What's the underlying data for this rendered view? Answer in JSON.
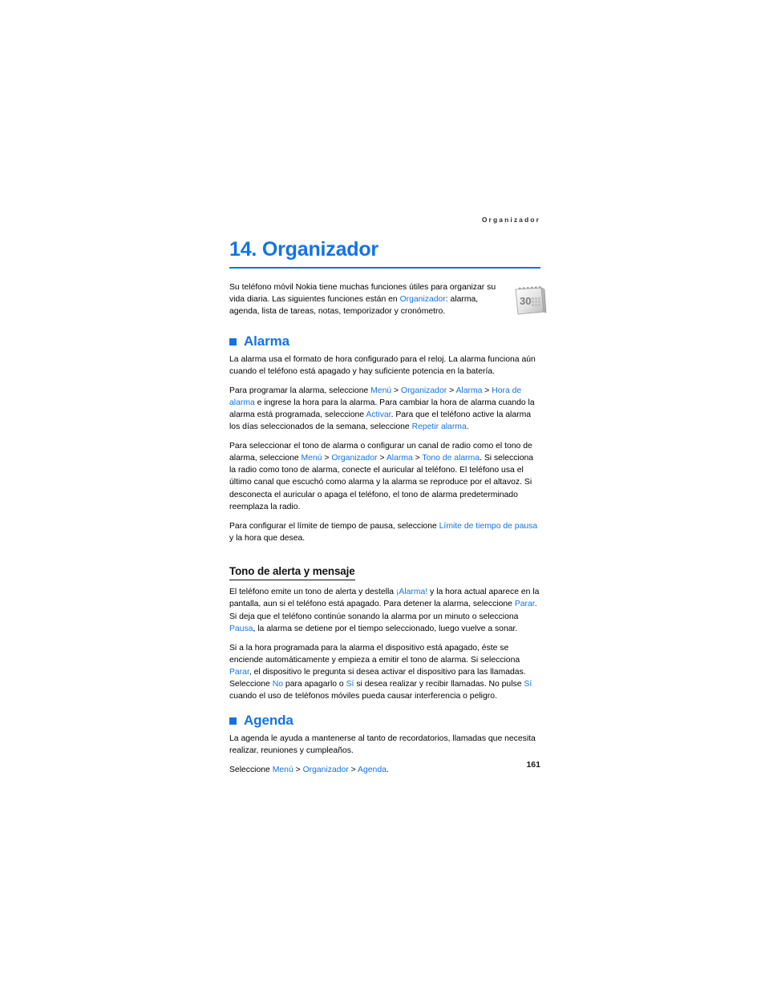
{
  "header": {
    "running_head": "Organizador"
  },
  "title": {
    "text": "14. Organizador"
  },
  "intro": {
    "paragraph_1": "Su teléfono móvil Nokia tiene muchas funciones útiles para organizar su vida diaria. Las siguientes funciones están en ",
    "link_organizador": "Organizador",
    "paragraph_1_tail": ": alarma, agenda, lista de tareas, notas, temporizador y cronómetro.",
    "icon": "calendar-icon",
    "icon_day": "30"
  },
  "sections": [
    {
      "heading": "Alarma",
      "bullet": "square-bullet",
      "paragraphs": {
        "p1": "La alarma usa el formato de hora configurado para el reloj. La alarma funciona aún cuando el teléfono está apagado y hay suficiente potencia en la batería.",
        "p2_a": "Para programar la alarma, seleccione ",
        "p2_l1": "Menú",
        "p2_sep1": " > ",
        "p2_l2": "Organizador",
        "p2_sep2": " > ",
        "p2_l3": "Alarma",
        "p2_sep3": " > ",
        "p2_l4": "Hora de alarma",
        "p2_b": " e ingrese la hora para la alarma. Para cambiar la hora de alarma cuando la alarma está programada, seleccione ",
        "p2_l5": "Activar",
        "p2_c": ". Para que el teléfono active la alarma los días seleccionados de la semana, seleccione ",
        "p2_l6": "Repetir alarma",
        "p2_d": ".",
        "p3_a": "Para seleccionar el tono de alarma o configurar un canal de radio como el tono de alarma, seleccione ",
        "p3_l1": "Menú",
        "p3_sep1": " > ",
        "p3_l2": "Organizador",
        "p3_sep2": " > ",
        "p3_l3": "Alarma",
        "p3_sep3": " > ",
        "p3_l4": "Tono de alarma",
        "p3_b": ". Si selecciona la radio como tono de alarma, conecte el auricular al teléfono. El teléfono usa el último canal que escuchó como alarma y la alarma se reproduce por el altavoz. Si desconecta el auricular o apaga el teléfono, el tono de alarma predeterminado reemplaza la radio.",
        "p4_a": "Para configurar el límite de tiempo de pausa, seleccione ",
        "p4_l1": "Límite de tiempo de pausa",
        "p4_b": " y la hora que desea."
      },
      "subsection": {
        "heading": "Tono de alerta y mensaje",
        "p1_a": "El teléfono emite un tono de alerta y destella ",
        "p1_l1": "¡Alarma!",
        "p1_b": " y la hora actual aparece en la pantalla, aun si el teléfono está apagado. Para detener la alarma, seleccione ",
        "p1_l2": "Parar",
        "p1_c": ". Si deja que el teléfono continúe sonando la alarma por un minuto o selecciona ",
        "p1_l3": "Pausa",
        "p1_d": ", la alarma se detiene por el tiempo seleccionado, luego vuelve a sonar.",
        "p2_a": "Si a la hora programada para la alarma el dispositivo está apagado, éste se enciende automáticamente y empieza a emitir el tono de alarma. Si selecciona ",
        "p2_l1": "Parar",
        "p2_b": ", el dispositivo le pregunta si desea activar el dispositivo para las llamadas. Seleccione ",
        "p2_l2": "No",
        "p2_c": " para apagarlo o ",
        "p2_l3": "Sí",
        "p2_d": " si desea realizar y recibir llamadas. No pulse ",
        "p2_l4": "Sí",
        "p2_e": " cuando el uso de teléfonos móviles pueda causar interferencia o peligro."
      }
    },
    {
      "heading": "Agenda",
      "bullet": "square-bullet",
      "paragraphs": {
        "p1": "La agenda le ayuda a mantenerse al tanto de recordatorios, llamadas que necesita realizar, reuniones y cumpleaños.",
        "p2_a": "Seleccione ",
        "p2_l1": "Menú",
        "p2_sep1": " > ",
        "p2_l2": "Organizador",
        "p2_sep2": " > ",
        "p2_l3": "Agenda",
        "p2_b": "."
      }
    }
  ],
  "footer": {
    "page_number": "161"
  },
  "colors": {
    "accent_blue": "#1273e6",
    "body_black": "#000000"
  }
}
